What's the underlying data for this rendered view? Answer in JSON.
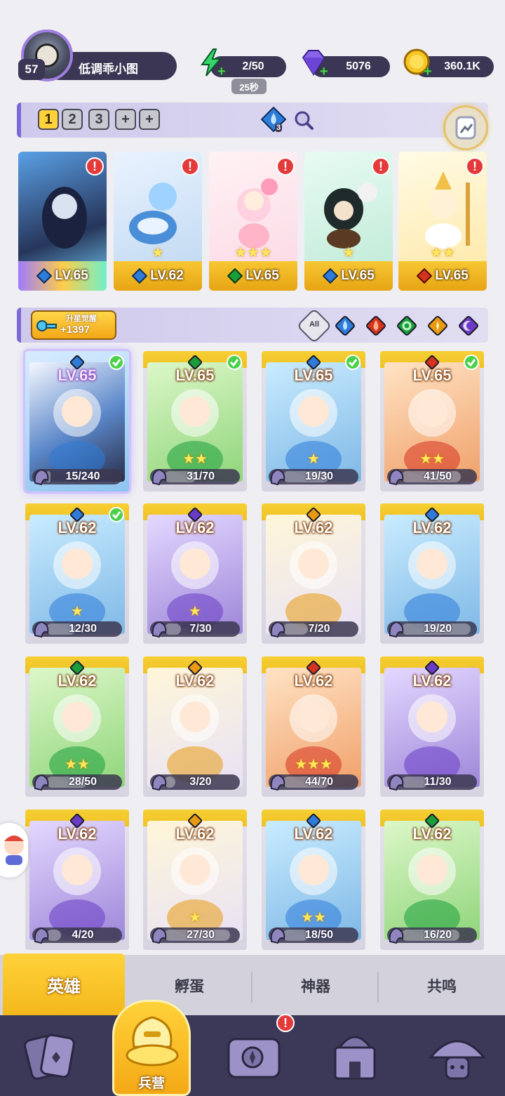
{
  "profile": {
    "level": "57",
    "name": "低调乖小图"
  },
  "resources": {
    "energy": "2/50",
    "energy_timer": "25秒",
    "gems": "5076",
    "gold": "360.1K"
  },
  "team": {
    "tabs": [
      "1",
      "2",
      "3"
    ],
    "active_tab": "1",
    "team_count": "3",
    "cards": [
      {
        "level": "LV.65",
        "element": "water",
        "stars": "",
        "alert": "!"
      },
      {
        "level": "LV.62",
        "element": "water",
        "stars": "★",
        "alert": "!"
      },
      {
        "level": "LV.65",
        "element": "nature",
        "stars": "★★★",
        "alert": "!"
      },
      {
        "level": "LV.65",
        "element": "water",
        "stars": "★",
        "alert": "!"
      },
      {
        "level": "LV.65",
        "element": "fire",
        "stars": "★★",
        "alert": "!"
      }
    ]
  },
  "filter": {
    "awaken_label": "升星觉醒",
    "awaken_value": "+1397",
    "all_label": "All"
  },
  "heroes": [
    {
      "level": "LV.65",
      "progress": "15/240",
      "fraction": 0.06,
      "stars": "",
      "element": "water",
      "checked": true,
      "selected": true
    },
    {
      "level": "LV.65",
      "progress": "31/70",
      "fraction": 0.44,
      "stars": "★★",
      "element": "nature",
      "checked": true
    },
    {
      "level": "LV.65",
      "progress": "19/30",
      "fraction": 0.63,
      "stars": "★",
      "element": "water",
      "checked": true
    },
    {
      "level": "LV.65",
      "progress": "41/50",
      "fraction": 0.82,
      "stars": "★★",
      "element": "fire",
      "checked": true
    },
    {
      "level": "LV.62",
      "progress": "12/30",
      "fraction": 0.4,
      "stars": "★",
      "element": "water",
      "checked": true
    },
    {
      "level": "LV.62",
      "progress": "7/30",
      "fraction": 0.23,
      "stars": "★",
      "element": "dark",
      "checked": false
    },
    {
      "level": "LV.62",
      "progress": "7/20",
      "fraction": 0.35,
      "stars": "",
      "element": "light",
      "checked": false
    },
    {
      "level": "LV.62",
      "progress": "19/20",
      "fraction": 0.95,
      "stars": "",
      "element": "water",
      "checked": false
    },
    {
      "level": "LV.62",
      "progress": "28/50",
      "fraction": 0.56,
      "stars": "★★",
      "element": "nature",
      "checked": false
    },
    {
      "level": "LV.62",
      "progress": "3/20",
      "fraction": 0.15,
      "stars": "",
      "element": "light",
      "checked": false
    },
    {
      "level": "LV.62",
      "progress": "44/70",
      "fraction": 0.63,
      "stars": "★★★",
      "element": "fire",
      "checked": false
    },
    {
      "level": "LV.62",
      "progress": "11/30",
      "fraction": 0.37,
      "stars": "",
      "element": "dark",
      "checked": false
    },
    {
      "level": "LV.62",
      "progress": "4/20",
      "fraction": 0.2,
      "stars": "",
      "element": "dark",
      "checked": false
    },
    {
      "level": "LV.62",
      "progress": "27/30",
      "fraction": 0.9,
      "stars": "★",
      "element": "light",
      "checked": false
    },
    {
      "level": "LV.62",
      "progress": "18/50",
      "fraction": 0.36,
      "stars": "★★",
      "element": "water",
      "checked": false
    },
    {
      "level": "LV.62",
      "progress": "16/20",
      "fraction": 0.8,
      "stars": "",
      "element": "nature",
      "checked": false
    }
  ],
  "subtabs": {
    "hero": "英雄",
    "hatch": "孵蛋",
    "artifact": "神器",
    "resonance": "共鸣"
  },
  "bottom_nav": {
    "active_label": "兵营",
    "alert": "!"
  },
  "colors": {
    "water": "#2e7bd9",
    "fire": "#d5331f",
    "nature": "#1a9e3a",
    "light": "#e89a12",
    "dark": "#6a3cc4",
    "gold": "#f6c624",
    "panel": "#3a3654"
  }
}
